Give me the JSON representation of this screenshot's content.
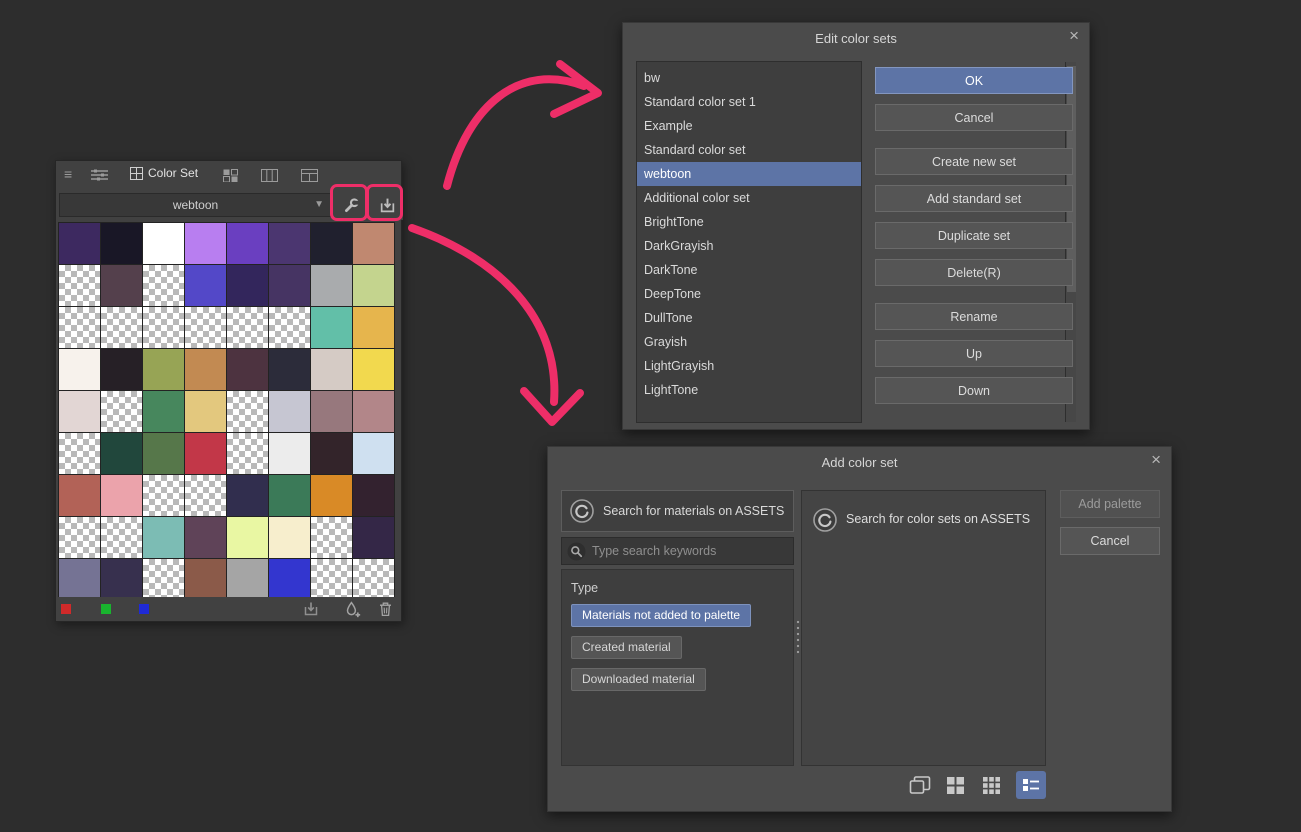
{
  "colors": {
    "accent_blue": "#5d74a6",
    "highlight_pink": "#ee2e68",
    "background": "#2d2d2d"
  },
  "icons": {
    "close": "×",
    "menu": "≡",
    "chevron_down": "▼"
  },
  "palette_panel": {
    "tab_label": "Color Set",
    "dropdown_value": "webtoon",
    "swatches": [
      "#3d2960",
      "#191726",
      "#ffffff",
      "#b87ef0",
      "#6a3fc0",
      "#4b3670",
      "#20202e",
      "#c08870",
      "checker",
      "#54404c",
      "checker",
      "#5348c8",
      "#33265c",
      "#463463",
      "#a9abad",
      "#c4d48e",
      "checker",
      "checker",
      "checker",
      "checker",
      "checker",
      "checker",
      "#62bfa8",
      "#e6b54d",
      "#f7f2ec",
      "#262026",
      "#97a455",
      "#c28a52",
      "#4d3340",
      "#2c2c3a",
      "#d5cbc5",
      "#f2d94e",
      "#e2d6d4",
      "checker",
      "#47875d",
      "#e3c87e",
      "checker",
      "#c6c6d2",
      "#97787d",
      "#b28689",
      "checker",
      "#21473c",
      "#56774a",
      "#c23748",
      "checker",
      "#ececec",
      "#33242a",
      "#cfe0f0",
      "#b26257",
      "#eba3ab",
      "checker",
      "checker",
      "#312e4e",
      "#3b7a58",
      "#d98a26",
      "#33222f",
      "checker",
      "checker",
      "#7cbcb4",
      "#5f4358",
      "#e9f7a3",
      "#f7eecd",
      "checker",
      "#342747",
      "#757394",
      "#37304e",
      "checker",
      "#8b5a49",
      "#a5a5a5",
      "#3336cf",
      "checker",
      "checker"
    ]
  },
  "edit_dialog": {
    "title": "Edit color sets",
    "selected_item": "webtoon",
    "items": [
      "bw",
      "Standard color set 1",
      "Example",
      "Standard color set",
      "webtoon",
      "Additional color set",
      "BrightTone",
      "DarkGrayish",
      "DarkTone",
      "DeepTone",
      "DullTone",
      "Grayish",
      "LightGrayish",
      "LightTone"
    ],
    "buttons": [
      {
        "label": "OK",
        "name": "ok-button",
        "primary": true
      },
      {
        "label": "Cancel",
        "name": "cancel-button"
      },
      {
        "label": "Create new set",
        "name": "create-new-set-button",
        "gap": true
      },
      {
        "label": "Add standard set",
        "name": "add-standard-set-button"
      },
      {
        "label": "Duplicate set",
        "name": "duplicate-set-button"
      },
      {
        "label": "Delete(R)",
        "name": "delete-set-button"
      },
      {
        "label": "Rename",
        "name": "rename-button",
        "gap": true
      },
      {
        "label": "Up",
        "name": "up-button"
      },
      {
        "label": "Down",
        "name": "down-button"
      }
    ]
  },
  "add_dialog": {
    "title": "Add color set",
    "assets_search_label": "Search for materials on ASSETS",
    "search_placeholder": "Type search keywords",
    "type_label": "Type",
    "filters": [
      "Materials not added to palette",
      "Created material",
      "Downloaded material"
    ],
    "selected_filter": "Materials not added to palette",
    "right_panel_label": "Search for color sets on ASSETS",
    "add_palette_label": "Add palette",
    "cancel_label": "Cancel"
  }
}
